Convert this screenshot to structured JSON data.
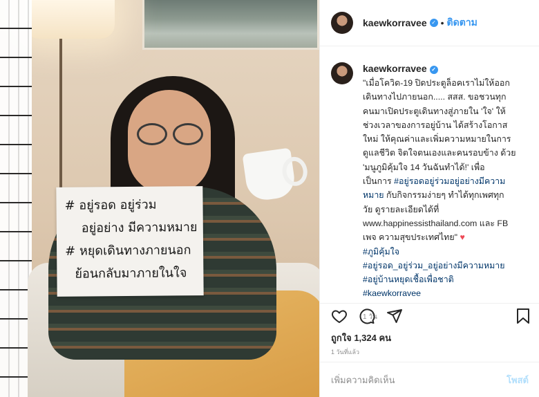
{
  "header": {
    "username": "kaewkorravee",
    "separator": "•",
    "follow_label": "ติดตาม"
  },
  "sign": {
    "lines": [
      "# อยู่รอด อยู่ร่วม",
      "อยู่อย่าง มีความหมาย",
      "# หยุดเดินทางภายนอก",
      "ย้อนกลับมาภายในใจ"
    ]
  },
  "caption": {
    "username": "kaewkorravee",
    "lines": [
      "\"เมื่อโควิด-19 ปิดประตูล็อคเราไม่ให้ออก",
      "เดินทางไปภายนอก..... สสส. ขอชวนทุก",
      "คนมาเปิดประตูเดินทางสู่ภายใน 'ใจ' ให้",
      "ช่วงเวลาของการอยู่บ้าน ได้สร้างโอกาส",
      "ใหม่ ให้คุณค่าและเพิ่มความหมายในการ",
      "ดูแลชีวิต จิตใจตนเองและคนรอบข้าง ด้วย",
      "'มนูภูมิคุ้มใจ 14 วันฉันทำได้!' เพื่อ"
    ],
    "line8_prefix": "เป็นการ ",
    "line8_tag": "#อยู่รอดอยู่ร่วมอยู่อย่างมีความ",
    "line9_tag": "หมาย",
    "line9_rest": " กับกิจกรรมง่ายๆ ทำได้ทุกเพศทุก",
    "line10": "วัย ดูรายละเอียดได้ที่",
    "line11": "www.happinessisthailand.com และ FB",
    "line12": "เพจ ความสุขประเทศไทย\" ",
    "heart": "♥",
    "hashtags": [
      "#ภูมิคุ้มใจ",
      "#อยู่รอด_อยู่ร่วม_อยู่อย่างมีความหมาย",
      "#อยู่บ้านหยุดเชื้อเพื่อชาติ",
      "#kaewkorravee"
    ],
    "time": "1 วัน"
  },
  "likes": "ถูกใจ 1,324 คน",
  "post_time": "1 วันที่แล้ว",
  "comment": {
    "placeholder": "เพิ่มความคิดเห็น",
    "post_label": "โพสต์"
  },
  "colors": {
    "accent": "#3897f0",
    "hashtag": "#003569",
    "heart": "#ed4956"
  }
}
